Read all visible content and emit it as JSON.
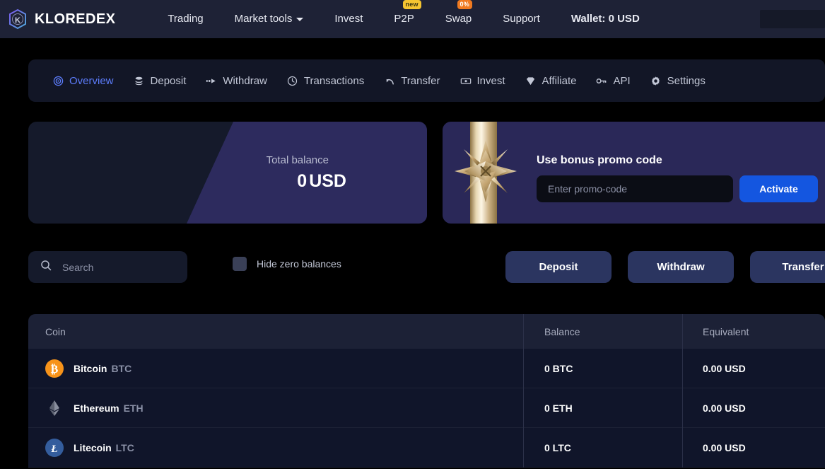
{
  "header": {
    "brand": "KLOREDEX",
    "logo_icon": "hexagon-k-logo",
    "nav": [
      {
        "label": "Trading",
        "icon": "",
        "badge": "",
        "caret": false
      },
      {
        "label": "Market tools",
        "icon": "",
        "badge": "",
        "caret": true
      },
      {
        "label": "Invest",
        "icon": "",
        "badge": "",
        "caret": false
      },
      {
        "label": "P2P",
        "icon": "",
        "badge": "new",
        "badge_type": "new",
        "caret": false
      },
      {
        "label": "Swap",
        "icon": "",
        "badge": "0%",
        "badge_type": "pct",
        "caret": false
      },
      {
        "label": "Support",
        "icon": "",
        "badge": "",
        "caret": false
      }
    ],
    "wallet": "Wallet: 0 USD"
  },
  "tabs": [
    {
      "label": "Overview",
      "icon": "target-icon",
      "active": true
    },
    {
      "label": "Deposit",
      "icon": "database-icon",
      "active": false
    },
    {
      "label": "Withdraw",
      "icon": "arrow-right-dots-icon",
      "active": false
    },
    {
      "label": "Transactions",
      "icon": "clock-icon",
      "active": false
    },
    {
      "label": "Transfer",
      "icon": "arrow-reply-icon",
      "active": false
    },
    {
      "label": "Invest",
      "icon": "banknote-icon",
      "active": false
    },
    {
      "label": "Affiliate",
      "icon": "diamond-icon",
      "active": false
    },
    {
      "label": "API",
      "icon": "key-icon",
      "active": false
    },
    {
      "label": "Settings",
      "icon": "gear-icon",
      "active": false
    }
  ],
  "balance_card": {
    "label": "Total balance",
    "amount": "0",
    "currency": "USD"
  },
  "promo_card": {
    "title": "Use bonus promo code",
    "input_value": "",
    "input_placeholder": "Enter promo-code",
    "button_label": "Activate",
    "decor_icon": "gift-bow-icon"
  },
  "filters": {
    "search_value": "",
    "search_placeholder": "Search",
    "search_icon": "search-icon",
    "hide_zero_label": "Hide zero balances",
    "hide_zero_checked": false
  },
  "actions": [
    {
      "label": "Deposit"
    },
    {
      "label": "Withdraw"
    },
    {
      "label": "Transfer"
    }
  ],
  "table": {
    "columns": [
      "Coin",
      "Balance",
      "Equivalent"
    ],
    "rows": [
      {
        "icon": "bitcoin-icon",
        "name": "Bitcoin",
        "symbol": "BTC",
        "balance": "0 BTC",
        "equivalent": "0.00 USD"
      },
      {
        "icon": "ethereum-icon",
        "name": "Ethereum",
        "symbol": "ETH",
        "balance": "0 ETH",
        "equivalent": "0.00 USD"
      },
      {
        "icon": "litecoin-icon",
        "name": "Litecoin",
        "symbol": "LTC",
        "balance": "0 LTC",
        "equivalent": "0.00 USD"
      }
    ]
  },
  "colors": {
    "header_bg": "#1e2236",
    "page_bg": "#000000",
    "accent_blue": "#5c7cfa",
    "button_blue": "#1456e0",
    "purple": "#2d2b5e",
    "badge_new": "#f5c531",
    "badge_pct": "#f07a20"
  }
}
